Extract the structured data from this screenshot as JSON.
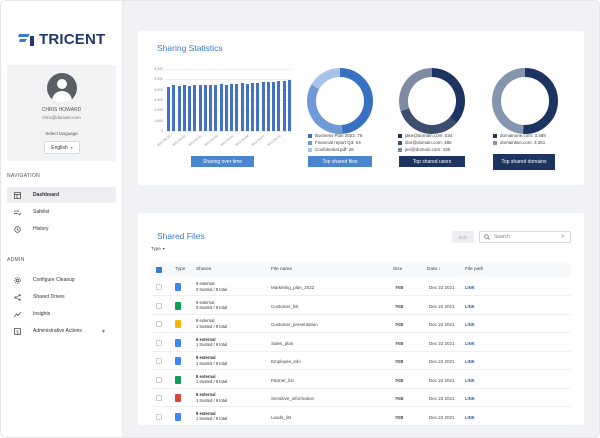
{
  "brand": {
    "name": "TRICENT"
  },
  "profile": {
    "name": "CHRIS HOWARD",
    "email": "chris@domain.com",
    "language_label": "Select language",
    "language": "English"
  },
  "nav": {
    "section1": "NAVIGATION",
    "items1": [
      {
        "label": "Dashboard",
        "icon": "dashboard-icon"
      },
      {
        "label": "Safelist",
        "icon": "safelist-icon"
      },
      {
        "label": "History",
        "icon": "history-icon"
      }
    ],
    "section2": "ADMIN",
    "items2": [
      {
        "label": "Configure Cleanup",
        "icon": "gear-icon"
      },
      {
        "label": "Shared Drives",
        "icon": "share-icon"
      },
      {
        "label": "Insights",
        "icon": "trend-icon"
      },
      {
        "label": "Administrative Actions",
        "icon": "admin-icon"
      }
    ]
  },
  "stats": {
    "title": "Sharing Statistics",
    "btn_time": "Sharing over time",
    "btn_files": "Top shared files",
    "btn_users": "Top shared users",
    "btn_domains": "Top shared domains",
    "files_legend": [
      "Business Plan 2022: 76",
      "Financial report Q3: 54",
      "Confidential.pdf: 26"
    ],
    "users_legend": [
      "jake@domain.com: 534",
      "dior@domain.com: 486",
      "jen@domain.com: 435"
    ],
    "domains_legend": [
      "domainone.com: 3,488",
      "domaintwo.com: 3,351"
    ]
  },
  "colors": {
    "accent": "#3b7ac9",
    "bar": "#4472c4",
    "dark_navy": "#1d3461"
  },
  "chart_data": [
    {
      "type": "bar",
      "y_tick_labels": [
        "6,000",
        "5,000",
        "4,000",
        "3,000",
        "2,000",
        "1,000",
        "0"
      ],
      "ylim": [
        0,
        6000
      ],
      "grid": true,
      "categories": [
        "2022-04-19",
        "2022-04-20",
        "2022-04-21",
        "2022-04-22",
        "2022-04-23",
        "2022-04-24",
        "2022-04-25",
        "2022-04-26",
        "2022-04-27",
        "2022-04-28",
        "2022-04-29",
        "2022-04-30",
        "2022-05-01",
        "2022-05-02",
        "2022-05-03",
        "2022-05-04",
        "2022-05-05",
        "2022-05-06",
        "2022-05-07",
        "2022-05-08",
        "2022-05-09",
        "2022-05-10",
        "2022-05-11",
        "2022-05-12"
      ],
      "x_tick_labels": [
        "2022-04-19",
        "2022-04-22",
        "2022-04-25",
        "2022-04-28",
        "2022-05-01",
        "2022-05-04",
        "2022-05-07",
        "2022-05-10"
      ],
      "values": [
        4300,
        4420,
        4380,
        4450,
        4400,
        4480,
        4430,
        4470,
        4500,
        4460,
        4520,
        4480,
        4540,
        4560,
        4600,
        4580,
        4620,
        4650,
        4700,
        4720,
        4760,
        4800,
        4850,
        4900
      ]
    },
    {
      "type": "pie",
      "donut": true,
      "labels": [
        "Business Plan 2022",
        "Financial report Q3",
        "Confidential.pdf"
      ],
      "values": [
        76,
        54,
        26
      ],
      "colors": [
        "#3a70c2",
        "#6f9ad6",
        "#a8c3ea"
      ]
    },
    {
      "type": "pie",
      "donut": true,
      "labels": [
        "jake@domain.com",
        "dior@domain.com",
        "jen@domain.com"
      ],
      "values": [
        534,
        486,
        435
      ],
      "colors": [
        "#1d3461",
        "#3c4d6d",
        "#7f8ba0"
      ]
    },
    {
      "type": "pie",
      "donut": true,
      "labels": [
        "domainone.com",
        "domaintwo.com"
      ],
      "values": [
        3488,
        3351
      ],
      "colors": [
        "#1d3461",
        "#8595ad"
      ]
    }
  ],
  "files": {
    "title": "Shared Files",
    "type_filter": "Type",
    "edit_label": "Edit",
    "search_placeholder": "Search",
    "headers": {
      "type": "Type",
      "shares": "Shares",
      "name": "File name",
      "size": "Size",
      "date": "Date",
      "path": "File path"
    },
    "rows": [
      {
        "icon": "doc",
        "color": "#4285f4",
        "s1": "9 external",
        "s2": "0 trusted / 9 total",
        "bold": false,
        "name": "Marketing_plan_2022",
        "size": "7KB",
        "date": "Dec 22 2021",
        "link": "LINK"
      },
      {
        "icon": "sheet",
        "color": "#0f9d58",
        "s1": "9 external",
        "s2": "0 trusted / 9 total",
        "bold": false,
        "name": "Customer_list",
        "size": "7KB",
        "date": "Dec 22 2021",
        "link": "LINK"
      },
      {
        "icon": "slides",
        "color": "#f4b400",
        "s1": "9 external",
        "s2": "1 trusted / 9 total",
        "bold": false,
        "name": "Customer_presentation",
        "size": "7KB",
        "date": "Dec 22 2021",
        "link": "LINK"
      },
      {
        "icon": "doc",
        "color": "#4285f4",
        "s1": "8 external",
        "s2": "1 trusted / 9 total",
        "bold": true,
        "name": "Sales_plan",
        "size": "7KB",
        "date": "Dec 22 2021",
        "link": "LINK"
      },
      {
        "icon": "doc",
        "color": "#4285f4",
        "s1": "8 external",
        "s2": "1 trusted / 9 total",
        "bold": true,
        "name": "Employee_info",
        "size": "7KB",
        "date": "Dec 22 2021",
        "link": "LINK"
      },
      {
        "icon": "sheet",
        "color": "#0f9d58",
        "s1": "8 external",
        "s2": "1 trusted / 9 total",
        "bold": true,
        "name": "Partner_list",
        "size": "7KB",
        "date": "Dec 22 2021",
        "link": "LINK"
      },
      {
        "icon": "pdf",
        "color": "#db4437",
        "s1": "8 external",
        "s2": "1 trusted / 9 total",
        "bold": true,
        "name": "Sensitive_information",
        "size": "7KB",
        "date": "Dec 22 2021",
        "link": "LINK"
      },
      {
        "icon": "doc",
        "color": "#4285f4",
        "s1": "8 external",
        "s2": "1 trusted / 9 total",
        "bold": true,
        "name": "Leads_list",
        "size": "7KB",
        "date": "Dec 22 2021",
        "link": "LINK"
      }
    ]
  }
}
